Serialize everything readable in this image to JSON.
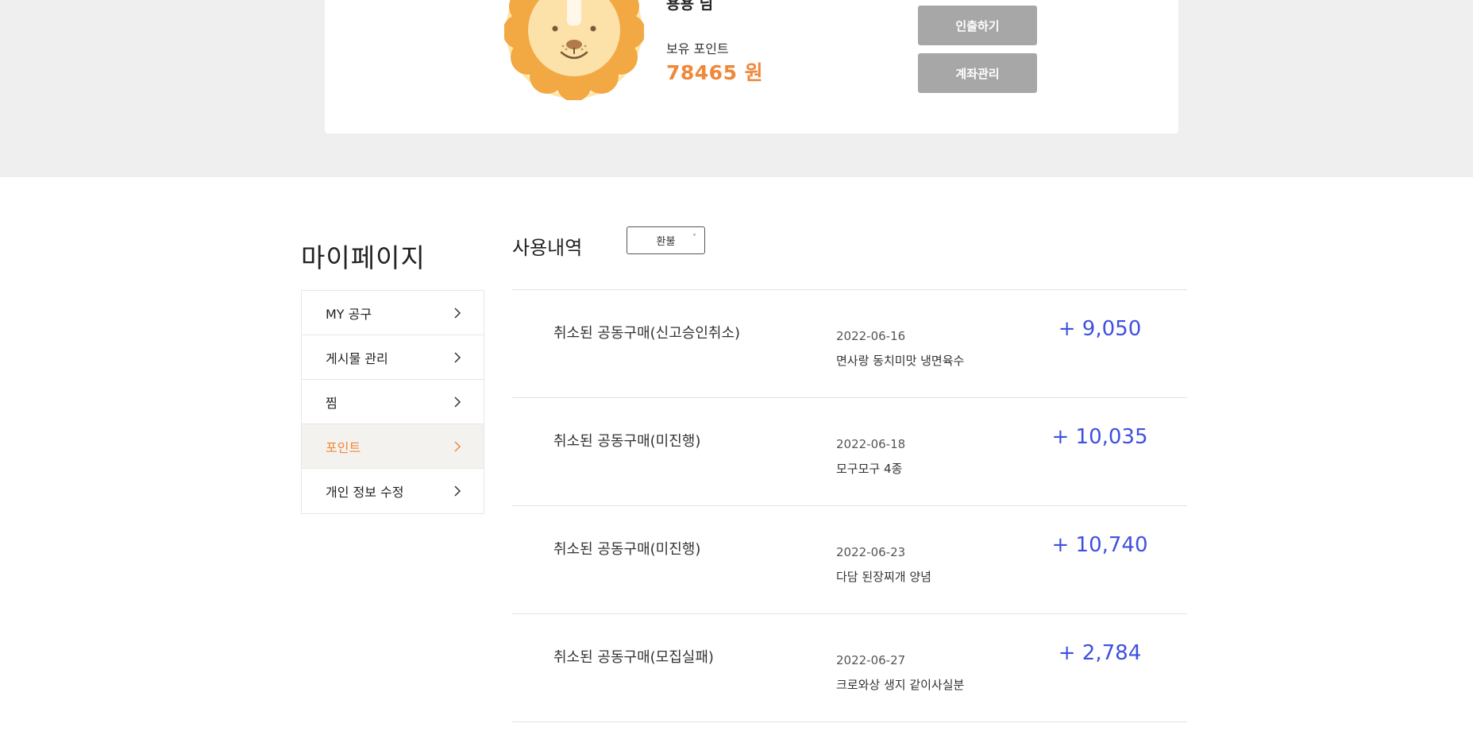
{
  "profile": {
    "nickname": "용용 님",
    "points_label": "보유 포인트",
    "points_value": "78465 원",
    "withdraw_button": "인출하기",
    "account_button": "계좌관리"
  },
  "page_title": "마이페이지",
  "sidebar": {
    "items": [
      {
        "label": "MY 공구"
      },
      {
        "label": "게시물 관리"
      },
      {
        "label": "찜"
      },
      {
        "label": "포인트"
      },
      {
        "label": "개인 정보 수정"
      }
    ],
    "active_index": 3
  },
  "history": {
    "title": "사용내역",
    "filter_value": "환불",
    "rows": [
      {
        "status": "취소된 공동구매(신고승인취소)",
        "date": "2022-06-16",
        "product": "면사랑 동치미맛 냉면육수",
        "amount": "+ 9,050"
      },
      {
        "status": "취소된 공동구매(미진행)",
        "date": "2022-06-18",
        "product": "모구모구 4종",
        "amount": "+ 10,035"
      },
      {
        "status": "취소된 공동구매(미진행)",
        "date": "2022-06-23",
        "product": "다담 된장찌개 양념",
        "amount": "+ 10,740"
      },
      {
        "status": "취소된 공동구매(모집실패)",
        "date": "2022-06-27",
        "product": "크로와상 생지 같이사실분",
        "amount": "+ 2,784"
      }
    ]
  },
  "colors": {
    "accent_orange": "#f0883a",
    "amount_blue": "#3e50e0",
    "button_gray": "#a7a7a7",
    "band_gray": "#efefef"
  },
  "icons": {
    "avatar": "lion-face-icon",
    "sidebar_chevron": "chevron-right-icon",
    "select_caret": "chevron-down-icon"
  }
}
